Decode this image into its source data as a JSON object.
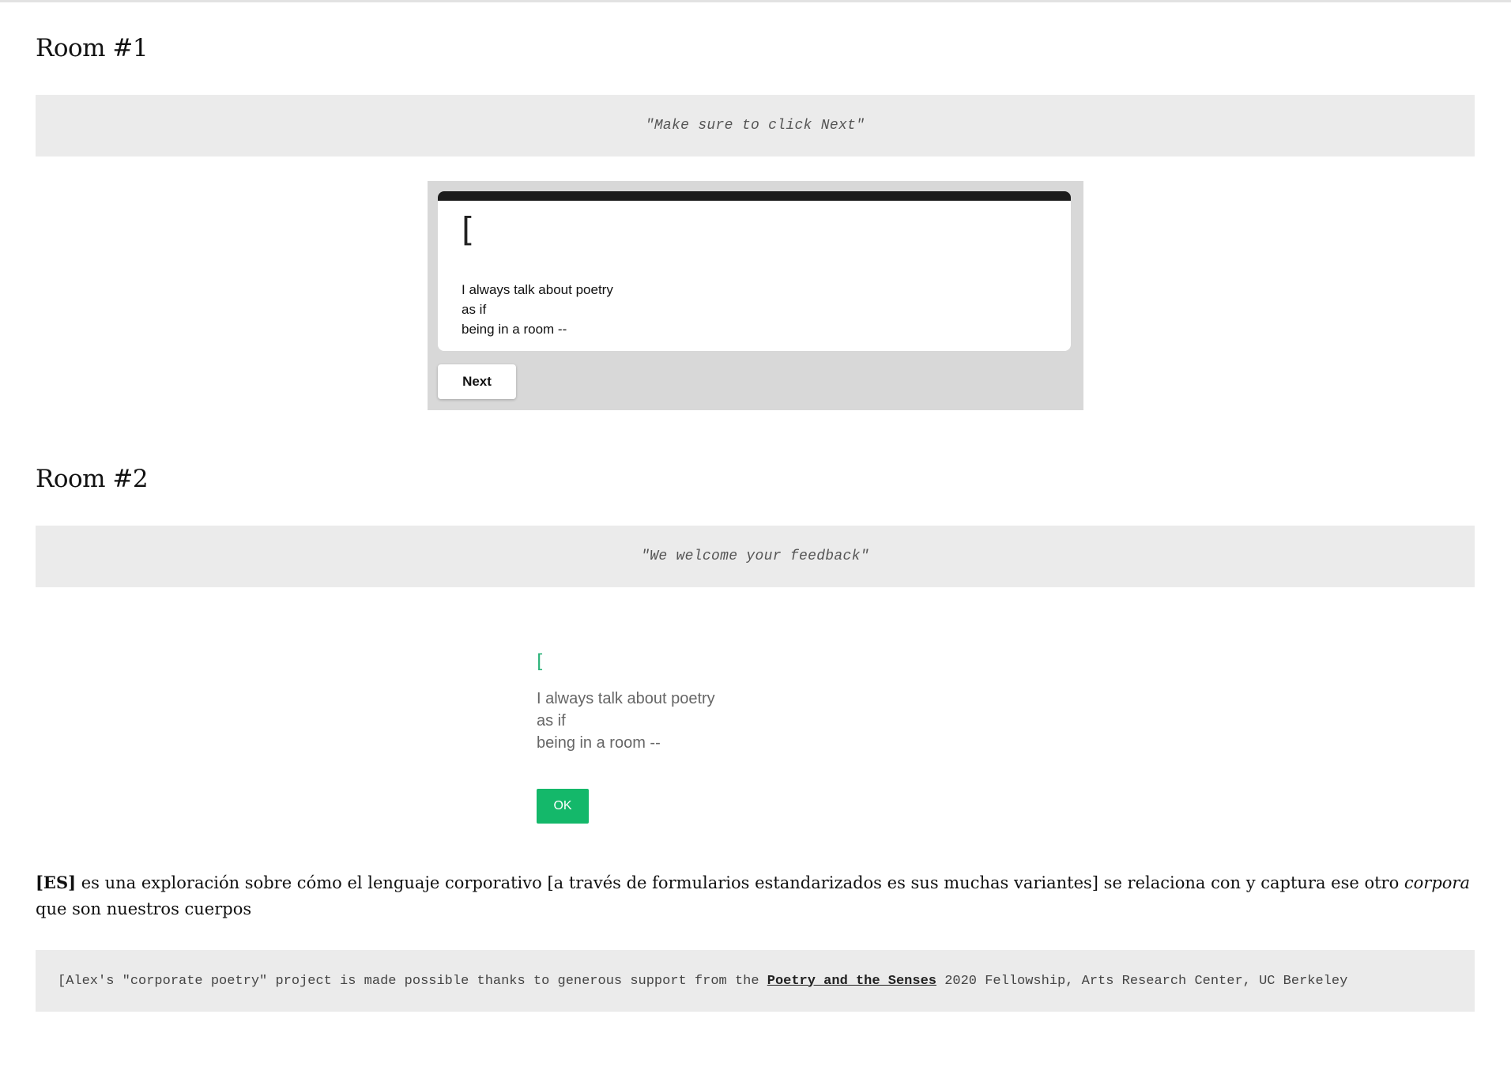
{
  "rooms": [
    {
      "title": "Room #1",
      "quote": "\"Make sure to click Next\"",
      "widget": {
        "bracket": "[",
        "lines": [
          "I always talk about poetry",
          "as if",
          "being in a room --"
        ],
        "button_label": "Next"
      }
    },
    {
      "title": "Room #2",
      "quote": "\"We welcome your feedback\"",
      "widget": {
        "bracket": "[",
        "lines": [
          "I always talk about poetry",
          "as if",
          "being in a room --"
        ],
        "button_label": "OK"
      }
    }
  ],
  "description": {
    "tag": "[ES]",
    "text_before": " es una exploración sobre cómo el lenguaje corporativo [a través de formularios estandarizados es sus muchas variantes] se relaciona con y captura ese otro ",
    "emphasis": "corpora",
    "text_after": " que son nuestros cuerpos"
  },
  "credit": {
    "prefix": "[Alex's \"corporate poetry\" project is made possible thanks to generous support from the ",
    "link_text": "Poetry and the Senses",
    "suffix": " 2020 Fellowship, Arts Research Center, UC Berkeley"
  },
  "colors": {
    "quote_bg": "#ebebeb",
    "ok_button": "#14b86a",
    "bracket_green": "#2db37a",
    "card_bar": "#1c1c1c"
  }
}
